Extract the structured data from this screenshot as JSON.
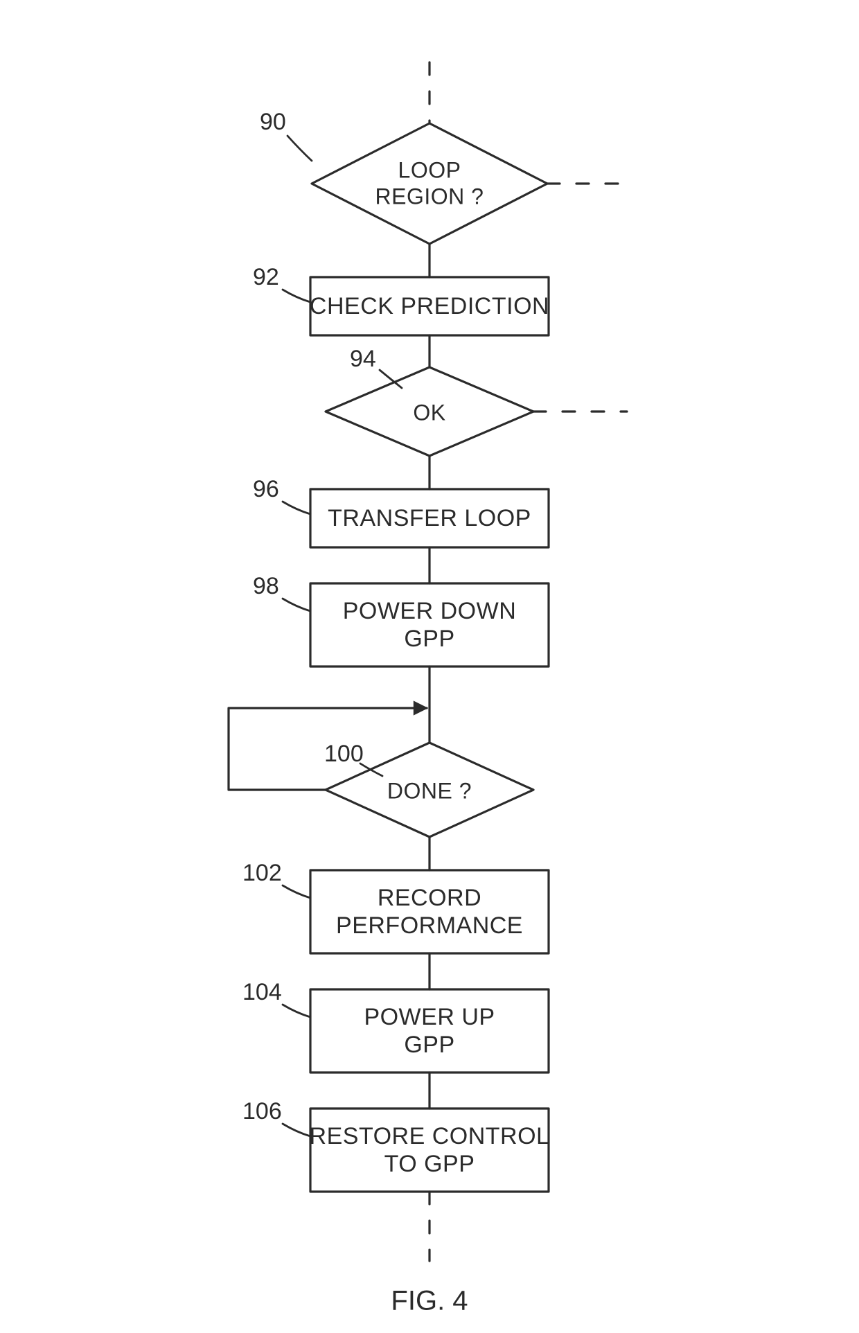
{
  "figure_caption": "FIG. 4",
  "nodes": {
    "n90": {
      "ref": "90",
      "label_lines": [
        "LOOP",
        "REGION ?"
      ]
    },
    "n92": {
      "ref": "92",
      "label_lines": [
        "CHECK PREDICTION"
      ]
    },
    "n94": {
      "ref": "94",
      "label_lines": [
        "OK"
      ]
    },
    "n96": {
      "ref": "96",
      "label_lines": [
        "TRANSFER LOOP"
      ]
    },
    "n98": {
      "ref": "98",
      "label_lines": [
        "POWER DOWN",
        "GPP"
      ]
    },
    "n100": {
      "ref": "100",
      "label_lines": [
        "DONE ?"
      ]
    },
    "n102": {
      "ref": "102",
      "label_lines": [
        "RECORD",
        "PERFORMANCE"
      ]
    },
    "n104": {
      "ref": "104",
      "label_lines": [
        "POWER UP",
        "GPP"
      ]
    },
    "n106": {
      "ref": "106",
      "label_lines": [
        "RESTORE CONTROL",
        "TO GPP"
      ]
    }
  },
  "chart_data": {
    "type": "flowchart",
    "nodes": [
      {
        "id": "90",
        "shape": "decision",
        "label": "LOOP REGION ?"
      },
      {
        "id": "92",
        "shape": "process",
        "label": "CHECK PREDICTION"
      },
      {
        "id": "94",
        "shape": "decision",
        "label": "OK"
      },
      {
        "id": "96",
        "shape": "process",
        "label": "TRANSFER LOOP"
      },
      {
        "id": "98",
        "shape": "process",
        "label": "POWER DOWN GPP"
      },
      {
        "id": "100",
        "shape": "decision",
        "label": "DONE ?"
      },
      {
        "id": "102",
        "shape": "process",
        "label": "RECORD PERFORMANCE"
      },
      {
        "id": "104",
        "shape": "process",
        "label": "POWER UP GPP"
      },
      {
        "id": "106",
        "shape": "process",
        "label": "RESTORE CONTROL TO GPP"
      }
    ],
    "edges": [
      {
        "from": "entry",
        "to": "90",
        "style": "dashed"
      },
      {
        "from": "90",
        "to": "92"
      },
      {
        "from": "90",
        "to": "exit_right_1",
        "style": "dashed"
      },
      {
        "from": "92",
        "to": "94"
      },
      {
        "from": "94",
        "to": "96"
      },
      {
        "from": "94",
        "to": "exit_right_2",
        "style": "dashed"
      },
      {
        "from": "96",
        "to": "98"
      },
      {
        "from": "98",
        "to": "100"
      },
      {
        "from": "100",
        "to": "100",
        "note": "loop back (left)"
      },
      {
        "from": "100",
        "to": "102"
      },
      {
        "from": "102",
        "to": "104"
      },
      {
        "from": "104",
        "to": "106"
      },
      {
        "from": "106",
        "to": "exit_bottom",
        "style": "dashed"
      }
    ]
  }
}
